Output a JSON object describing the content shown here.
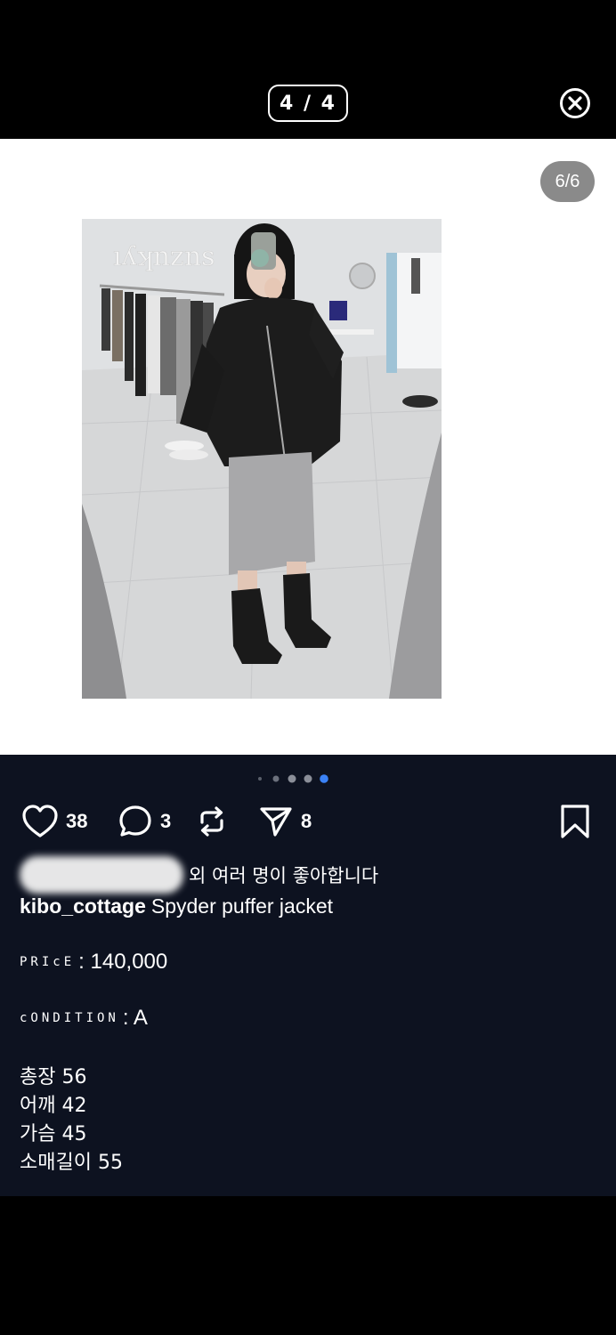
{
  "viewer": {
    "counter": "4 / 4",
    "close_icon": "close-circle-icon"
  },
  "media": {
    "badge": "6/6",
    "carousel": {
      "total": 5,
      "active_index": 4
    }
  },
  "actions": {
    "likes": "38",
    "comments": "3",
    "shares": "8",
    "icons": [
      "heart-icon",
      "comment-icon",
      "repost-icon",
      "send-icon",
      "bookmark-icon"
    ]
  },
  "post": {
    "liked_by_suffix": "외 여러 명이 좋아합니다",
    "username": "kibo_cottage",
    "caption": "Spyder puffer jacket",
    "price_key": "PRIcE",
    "price_value": ": 140,000",
    "condition_key": "cONDITION",
    "condition_value": ": A",
    "sizes": [
      "총장 56",
      "어깨 42",
      "가슴 45",
      "소매길이 55"
    ]
  },
  "colors": {
    "background": "#000000",
    "post_background": "#0d1220",
    "badge": "#8a8a8a",
    "dot_active": "#3b82f6"
  }
}
